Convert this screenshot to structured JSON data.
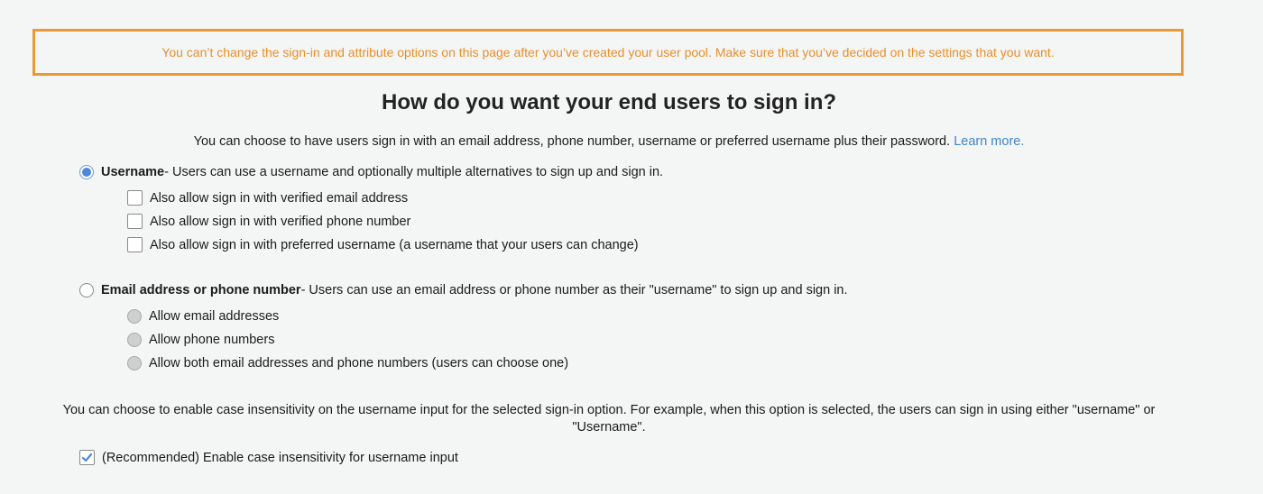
{
  "warning": {
    "text": "You can’t change the sign-in and attribute options on this page after you’ve created your user pool. Make sure that you’ve decided on the settings that you want."
  },
  "heading": "How do you want your end users to sign in?",
  "intro": {
    "text": "You can choose to have users sign in with an email address, phone number, username or preferred username plus their password.",
    "link": "Learn more."
  },
  "options": {
    "username": {
      "label": "Username",
      "description": " - Users can use a username and optionally multiple alternatives to sign up and sign in.",
      "selected": true,
      "sub_options": [
        {
          "label": "Also allow sign in with verified email address",
          "checked": false
        },
        {
          "label": "Also allow sign in with verified phone number",
          "checked": false
        },
        {
          "label": "Also allow sign in with preferred username (a username that your users can change)",
          "checked": false
        }
      ]
    },
    "email_phone": {
      "label": "Email address or phone number",
      "description": " - Users can use an email address or phone number as their \"username\" to sign up and sign in.",
      "selected": false,
      "sub_options": [
        {
          "label": "Allow email addresses",
          "selected": false,
          "disabled": true
        },
        {
          "label": "Allow phone numbers",
          "selected": false,
          "disabled": true
        },
        {
          "label": "Allow both email addresses and phone numbers (users can choose one)",
          "selected": false,
          "disabled": true
        }
      ]
    }
  },
  "case_insensitivity": {
    "description": "You can choose to enable case insensitivity on the username input for the selected sign-in option. For example, when this option is selected, the users can sign in using either \"username\" or \"Username\".",
    "checkbox_label": "(Recommended) Enable case insensitivity for username input",
    "checked": true
  },
  "colors": {
    "warning": "#ec9933",
    "link": "#3f86cc",
    "radio_selected": "#4a89dc"
  }
}
